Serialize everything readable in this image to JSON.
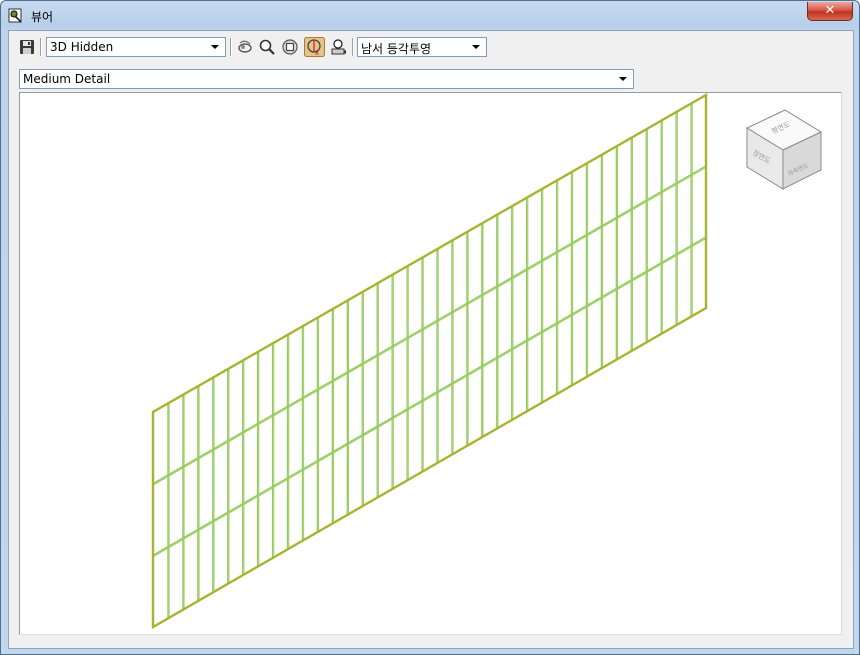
{
  "window": {
    "title": "뷰어",
    "close_label": "✕"
  },
  "toolbar": {
    "visual_style": "3D Hidden",
    "view_orientation": "남서 등각투영",
    "detail_level": "Medium Detail",
    "icons": [
      "save-icon",
      "orbit-icon",
      "zoom-icon",
      "zoom-extents-icon",
      "orbit-pan-icon",
      "camera-icon"
    ]
  },
  "viewcube": {
    "faces": [
      "평면도",
      "정면도",
      "좌측면도"
    ]
  },
  "colors": {
    "frame_outline": "#a8b430",
    "grid_line": "#8fcf60",
    "grid_shadow": "#a8c860"
  }
}
